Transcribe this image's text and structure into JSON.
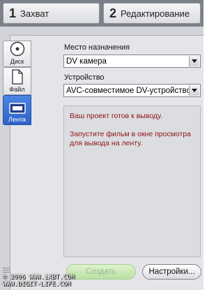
{
  "steps": [
    {
      "number": "1",
      "label": "Захват"
    },
    {
      "number": "2",
      "label": "Редактирование"
    }
  ],
  "side_tabs": [
    {
      "label": "Диск",
      "icon": "disc-icon"
    },
    {
      "label": "Файл",
      "icon": "file-icon"
    },
    {
      "label": "Лента",
      "icon": "tape-icon",
      "selected": true
    }
  ],
  "destination": {
    "label": "Место назначения",
    "value": "DV камера"
  },
  "device": {
    "label": "Устройство",
    "value": "AVC-совместимое DV-устройство"
  },
  "message": {
    "line1": "Ваш проект готов к выводу.",
    "line2": "Запустите фильм в окне просмотра для вывода на ленту."
  },
  "buttons": {
    "create": "Создать",
    "settings": "Настройки..."
  },
  "watermark": {
    "line1": "© 2006 WWW.iXBT.COM",
    "line2": "WWW.DIGIT-LIFE.COM"
  },
  "colors": {
    "accent": "#2f63c9",
    "message_text": "#8b1414"
  }
}
